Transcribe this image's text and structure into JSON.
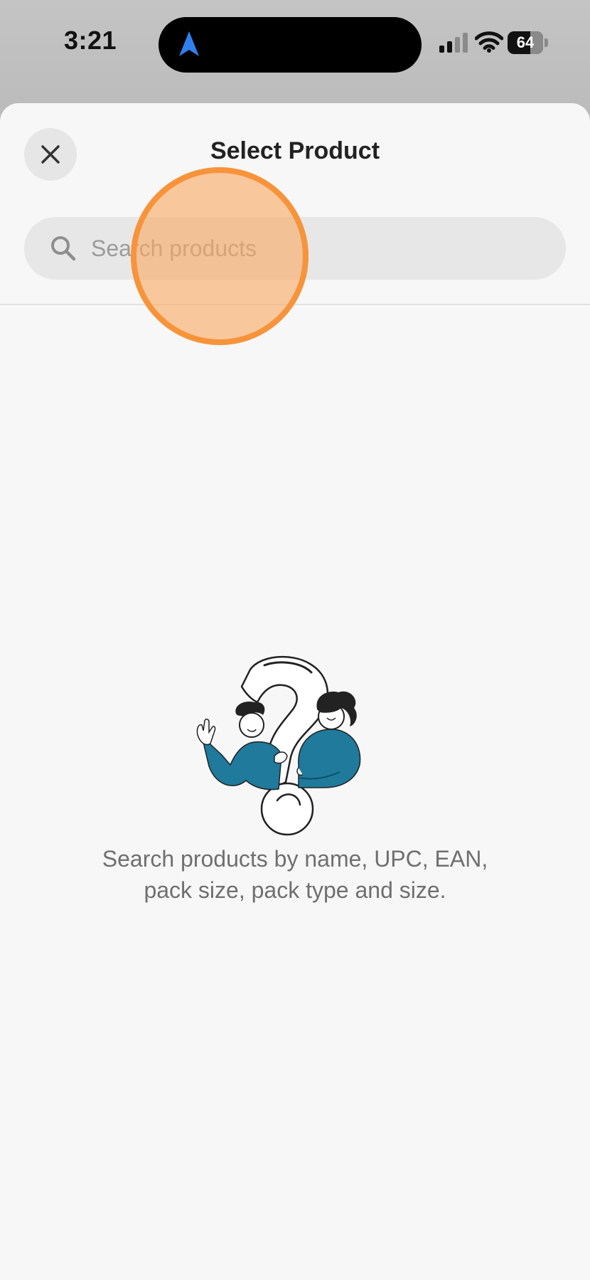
{
  "status_bar": {
    "time": "3:21",
    "battery_level": 64,
    "battery_text": "64",
    "icons": [
      "location-arrow-icon",
      "signal-icon",
      "wifi-icon",
      "battery-icon"
    ],
    "location_arrow_color": "#2f80ed"
  },
  "sheet": {
    "title": "Select Product",
    "close_icon": "close-icon"
  },
  "search": {
    "placeholder": "Search products",
    "value": "",
    "icon": "search-icon"
  },
  "empty_state": {
    "illustration": "people-question-mark-illustration",
    "message_line1": "Search products by name, UPC, EAN,",
    "message_line2": "pack size, pack type and size.",
    "accent_color": "#1f7a9c"
  },
  "tap_indicator": {
    "color": "#f7933a"
  }
}
